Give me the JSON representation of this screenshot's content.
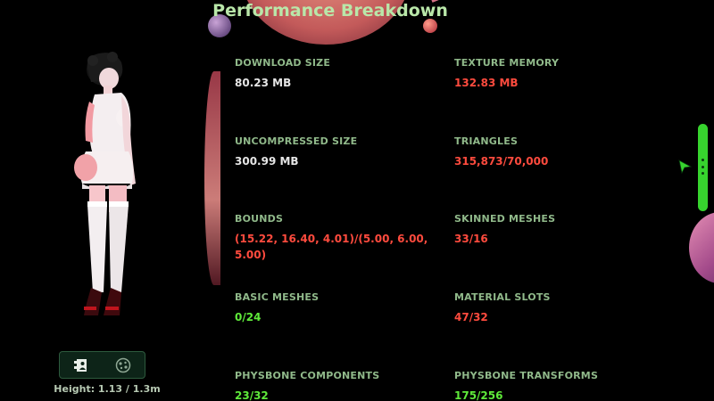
{
  "title": "Performance Breakdown",
  "colors": {
    "label": "#90b98a",
    "value_ok": "#e6e6e6",
    "value_bad": "#ff4b3e",
    "value_good": "#5fea3a",
    "accent_green": "#37d42e"
  },
  "stats": {
    "download_size": {
      "label": "DOWNLOAD SIZE",
      "value": "80.23 MB",
      "status": "neutral"
    },
    "texture_memory": {
      "label": "TEXTURE MEMORY",
      "value": "132.83 MB",
      "status": "bad"
    },
    "uncompressed_size": {
      "label": "UNCOMPRESSED SIZE",
      "value": "300.99 MB",
      "status": "neutral"
    },
    "triangles": {
      "label": "TRIANGLES",
      "value": "315,873/70,000",
      "status": "bad"
    },
    "bounds": {
      "label": "BOUNDS",
      "value": "(15.22, 16.40, 4.01)/(5.00, 6.00, 5.00)",
      "status": "bad"
    },
    "skinned_meshes": {
      "label": "SKINNED MESHES",
      "value": "33/16",
      "status": "bad"
    },
    "basic_meshes": {
      "label": "BASIC MESHES",
      "value": "0/24",
      "status": "good"
    },
    "material_slots": {
      "label": "MATERIAL SLOTS",
      "value": "47/32",
      "status": "bad"
    },
    "physbone_components": {
      "label": "PHYSBONE COMPONENTS",
      "value": "23/32",
      "status": "good"
    },
    "physbone_transforms": {
      "label": "PHYSBONE TRANSFORMS",
      "value": "175/256",
      "status": "good"
    }
  },
  "toolbar": {
    "buttons": [
      {
        "icon": "avatar-details-icon"
      },
      {
        "icon": "performance-icon"
      }
    ]
  },
  "height_label": "Height: 1.13 / 1.3m",
  "side_panel": {
    "icon": "more-vertical-icon"
  }
}
